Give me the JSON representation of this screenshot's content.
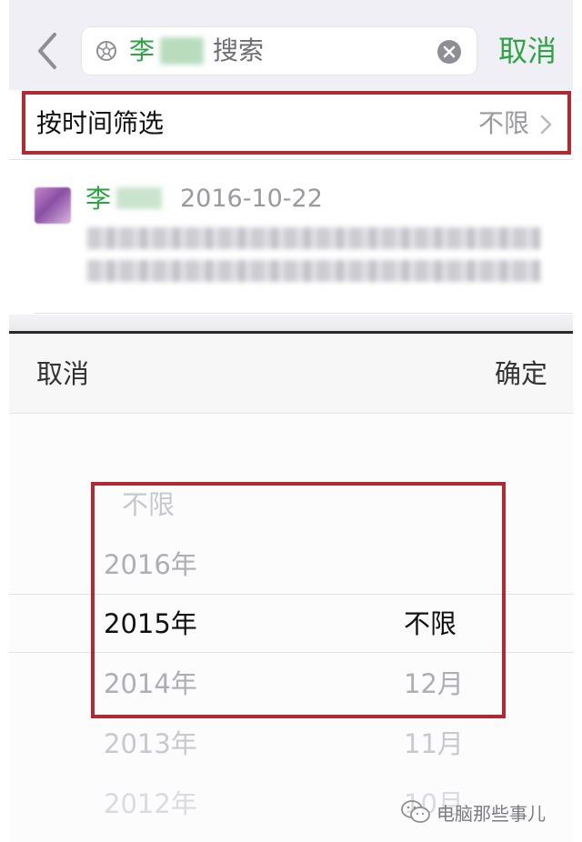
{
  "search": {
    "query_name": "李",
    "query_suffix": "搜索",
    "cancel_label": "取消"
  },
  "filter": {
    "label": "按时间筛选",
    "value": "不限"
  },
  "result": {
    "sender": "李",
    "date": "2016-10-22"
  },
  "picker": {
    "cancel_label": "取消",
    "confirm_label": "确定",
    "years": [
      "不限",
      "2016年",
      "2015年",
      "2014年",
      "2013年",
      "2012年"
    ],
    "months": [
      "不限",
      "12月",
      "11月",
      "10月"
    ],
    "selected_year": "2015年",
    "selected_month": "不限"
  },
  "watermark": {
    "text": "电脑那些事儿"
  },
  "colors": {
    "accent": "#2fa344",
    "highlight": "#b22934"
  }
}
